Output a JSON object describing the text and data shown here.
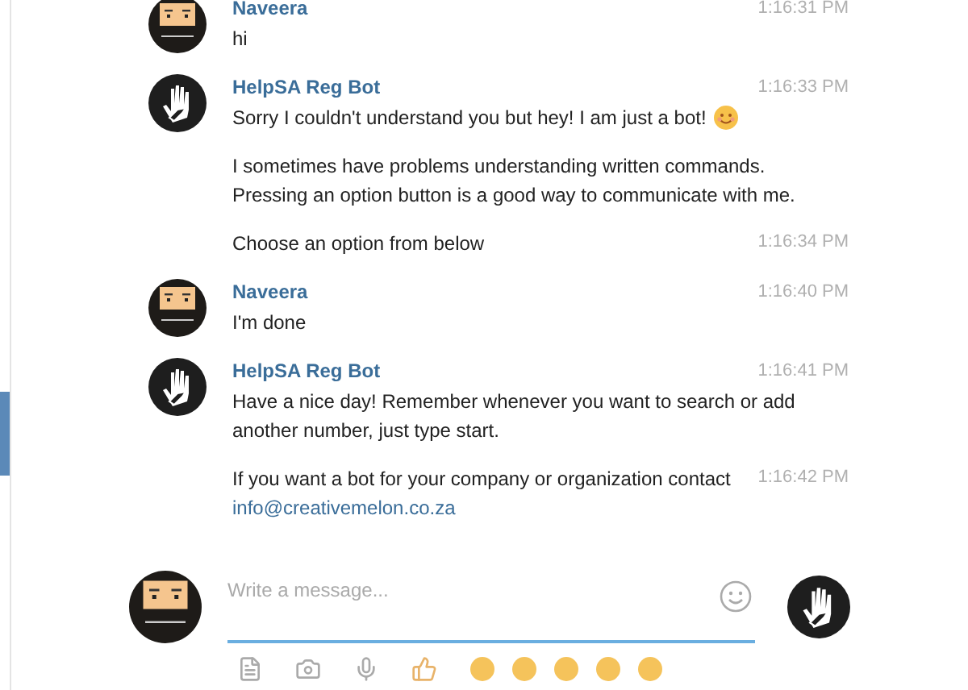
{
  "messages": [
    {
      "sender": "Naveera",
      "kind": "user",
      "time": "1:16:31 PM",
      "paragraphs": [
        {
          "text": "hi"
        }
      ]
    },
    {
      "sender": "HelpSA Reg Bot",
      "kind": "bot",
      "time": "1:16:33 PM",
      "paragraphs": [
        {
          "text": "Sorry I couldn't understand you but hey! I am just a bot!",
          "emoji": true
        },
        {
          "text": "I sometimes have problems understanding written commands.\nPressing an option button is a good way to communicate with me."
        },
        {
          "text": "Choose an option from below",
          "time": "1:16:34 PM"
        }
      ]
    },
    {
      "sender": "Naveera",
      "kind": "user",
      "time": "1:16:40 PM",
      "paragraphs": [
        {
          "text": "I'm done"
        }
      ]
    },
    {
      "sender": "HelpSA Reg Bot",
      "kind": "bot",
      "time": "1:16:41 PM",
      "paragraphs": [
        {
          "text": "Have a nice day! Remember whenever you want to search or add\nanother number, just type start."
        },
        {
          "text": "If you want a bot for your company or organization contact",
          "link": "info@creativemelon.co.za",
          "time": "1:16:42 PM"
        }
      ]
    }
  ],
  "composer": {
    "placeholder": "Write a message...",
    "avatars": [
      {
        "kind": "user"
      },
      {
        "kind": "bot"
      }
    ]
  }
}
